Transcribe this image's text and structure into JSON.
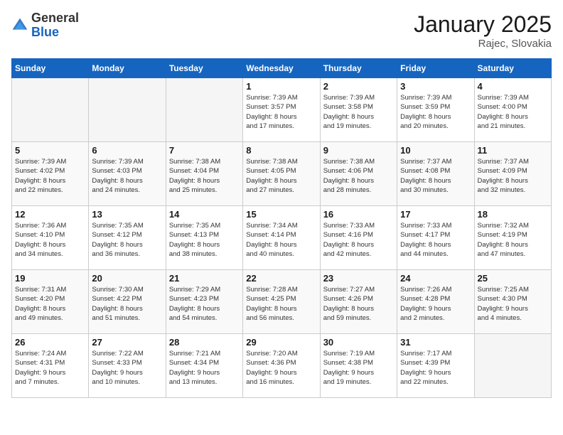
{
  "header": {
    "logo": {
      "general": "General",
      "blue": "Blue"
    },
    "title": "January 2025",
    "location": "Rajec, Slovakia"
  },
  "weekdays": [
    "Sunday",
    "Monday",
    "Tuesday",
    "Wednesday",
    "Thursday",
    "Friday",
    "Saturday"
  ],
  "weeks": [
    [
      {
        "num": "",
        "info": ""
      },
      {
        "num": "",
        "info": ""
      },
      {
        "num": "",
        "info": ""
      },
      {
        "num": "1",
        "info": "Sunrise: 7:39 AM\nSunset: 3:57 PM\nDaylight: 8 hours\nand 17 minutes."
      },
      {
        "num": "2",
        "info": "Sunrise: 7:39 AM\nSunset: 3:58 PM\nDaylight: 8 hours\nand 19 minutes."
      },
      {
        "num": "3",
        "info": "Sunrise: 7:39 AM\nSunset: 3:59 PM\nDaylight: 8 hours\nand 20 minutes."
      },
      {
        "num": "4",
        "info": "Sunrise: 7:39 AM\nSunset: 4:00 PM\nDaylight: 8 hours\nand 21 minutes."
      }
    ],
    [
      {
        "num": "5",
        "info": "Sunrise: 7:39 AM\nSunset: 4:02 PM\nDaylight: 8 hours\nand 22 minutes."
      },
      {
        "num": "6",
        "info": "Sunrise: 7:39 AM\nSunset: 4:03 PM\nDaylight: 8 hours\nand 24 minutes."
      },
      {
        "num": "7",
        "info": "Sunrise: 7:38 AM\nSunset: 4:04 PM\nDaylight: 8 hours\nand 25 minutes."
      },
      {
        "num": "8",
        "info": "Sunrise: 7:38 AM\nSunset: 4:05 PM\nDaylight: 8 hours\nand 27 minutes."
      },
      {
        "num": "9",
        "info": "Sunrise: 7:38 AM\nSunset: 4:06 PM\nDaylight: 8 hours\nand 28 minutes."
      },
      {
        "num": "10",
        "info": "Sunrise: 7:37 AM\nSunset: 4:08 PM\nDaylight: 8 hours\nand 30 minutes."
      },
      {
        "num": "11",
        "info": "Sunrise: 7:37 AM\nSunset: 4:09 PM\nDaylight: 8 hours\nand 32 minutes."
      }
    ],
    [
      {
        "num": "12",
        "info": "Sunrise: 7:36 AM\nSunset: 4:10 PM\nDaylight: 8 hours\nand 34 minutes."
      },
      {
        "num": "13",
        "info": "Sunrise: 7:35 AM\nSunset: 4:12 PM\nDaylight: 8 hours\nand 36 minutes."
      },
      {
        "num": "14",
        "info": "Sunrise: 7:35 AM\nSunset: 4:13 PM\nDaylight: 8 hours\nand 38 minutes."
      },
      {
        "num": "15",
        "info": "Sunrise: 7:34 AM\nSunset: 4:14 PM\nDaylight: 8 hours\nand 40 minutes."
      },
      {
        "num": "16",
        "info": "Sunrise: 7:33 AM\nSunset: 4:16 PM\nDaylight: 8 hours\nand 42 minutes."
      },
      {
        "num": "17",
        "info": "Sunrise: 7:33 AM\nSunset: 4:17 PM\nDaylight: 8 hours\nand 44 minutes."
      },
      {
        "num": "18",
        "info": "Sunrise: 7:32 AM\nSunset: 4:19 PM\nDaylight: 8 hours\nand 47 minutes."
      }
    ],
    [
      {
        "num": "19",
        "info": "Sunrise: 7:31 AM\nSunset: 4:20 PM\nDaylight: 8 hours\nand 49 minutes."
      },
      {
        "num": "20",
        "info": "Sunrise: 7:30 AM\nSunset: 4:22 PM\nDaylight: 8 hours\nand 51 minutes."
      },
      {
        "num": "21",
        "info": "Sunrise: 7:29 AM\nSunset: 4:23 PM\nDaylight: 8 hours\nand 54 minutes."
      },
      {
        "num": "22",
        "info": "Sunrise: 7:28 AM\nSunset: 4:25 PM\nDaylight: 8 hours\nand 56 minutes."
      },
      {
        "num": "23",
        "info": "Sunrise: 7:27 AM\nSunset: 4:26 PM\nDaylight: 8 hours\nand 59 minutes."
      },
      {
        "num": "24",
        "info": "Sunrise: 7:26 AM\nSunset: 4:28 PM\nDaylight: 9 hours\nand 2 minutes."
      },
      {
        "num": "25",
        "info": "Sunrise: 7:25 AM\nSunset: 4:30 PM\nDaylight: 9 hours\nand 4 minutes."
      }
    ],
    [
      {
        "num": "26",
        "info": "Sunrise: 7:24 AM\nSunset: 4:31 PM\nDaylight: 9 hours\nand 7 minutes."
      },
      {
        "num": "27",
        "info": "Sunrise: 7:22 AM\nSunset: 4:33 PM\nDaylight: 9 hours\nand 10 minutes."
      },
      {
        "num": "28",
        "info": "Sunrise: 7:21 AM\nSunset: 4:34 PM\nDaylight: 9 hours\nand 13 minutes."
      },
      {
        "num": "29",
        "info": "Sunrise: 7:20 AM\nSunset: 4:36 PM\nDaylight: 9 hours\nand 16 minutes."
      },
      {
        "num": "30",
        "info": "Sunrise: 7:19 AM\nSunset: 4:38 PM\nDaylight: 9 hours\nand 19 minutes."
      },
      {
        "num": "31",
        "info": "Sunrise: 7:17 AM\nSunset: 4:39 PM\nDaylight: 9 hours\nand 22 minutes."
      },
      {
        "num": "",
        "info": ""
      }
    ]
  ]
}
